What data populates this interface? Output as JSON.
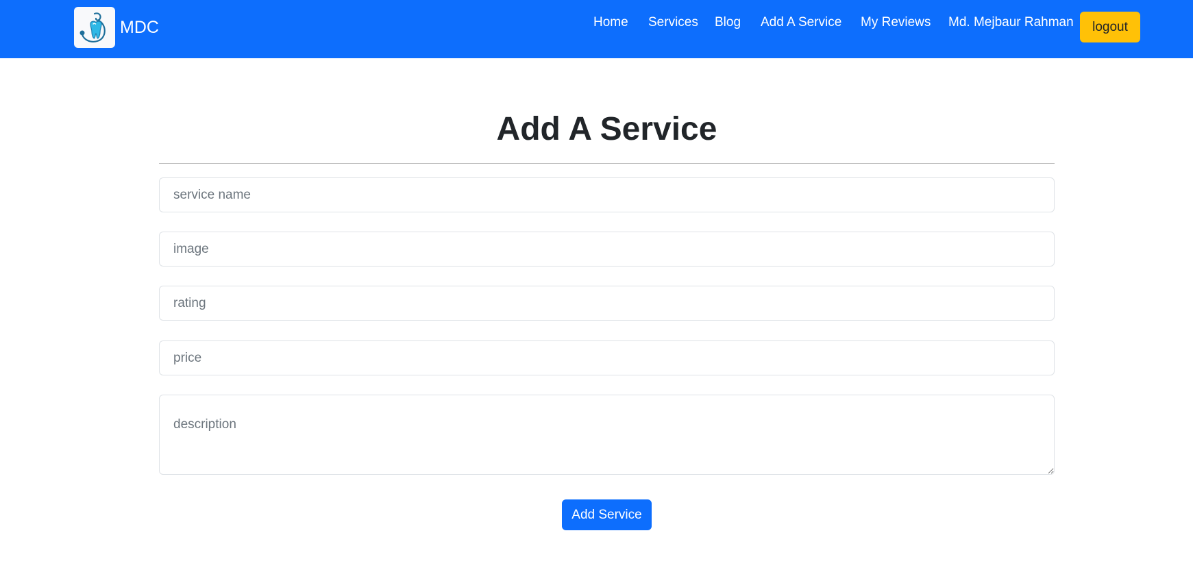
{
  "navbar": {
    "brand_text": "MDC",
    "logo_icon": "tooth-stethoscope-logo-icon",
    "links": [
      {
        "label": "Home"
      },
      {
        "label": "Services"
      },
      {
        "label": "Blog"
      },
      {
        "label": "Add A Service"
      },
      {
        "label": "My Reviews"
      }
    ],
    "user_name": "Md. Mejbaur Rahman",
    "logout_label": "logout",
    "bg_color": "#0d6efd",
    "logout_color": "#ffc107"
  },
  "form": {
    "title": "Add A Service",
    "service_name_placeholder": "service name",
    "image_placeholder": "image",
    "rating_placeholder": "rating",
    "price_placeholder": "price",
    "description_placeholder": "description",
    "submit_label": "Add Service"
  }
}
